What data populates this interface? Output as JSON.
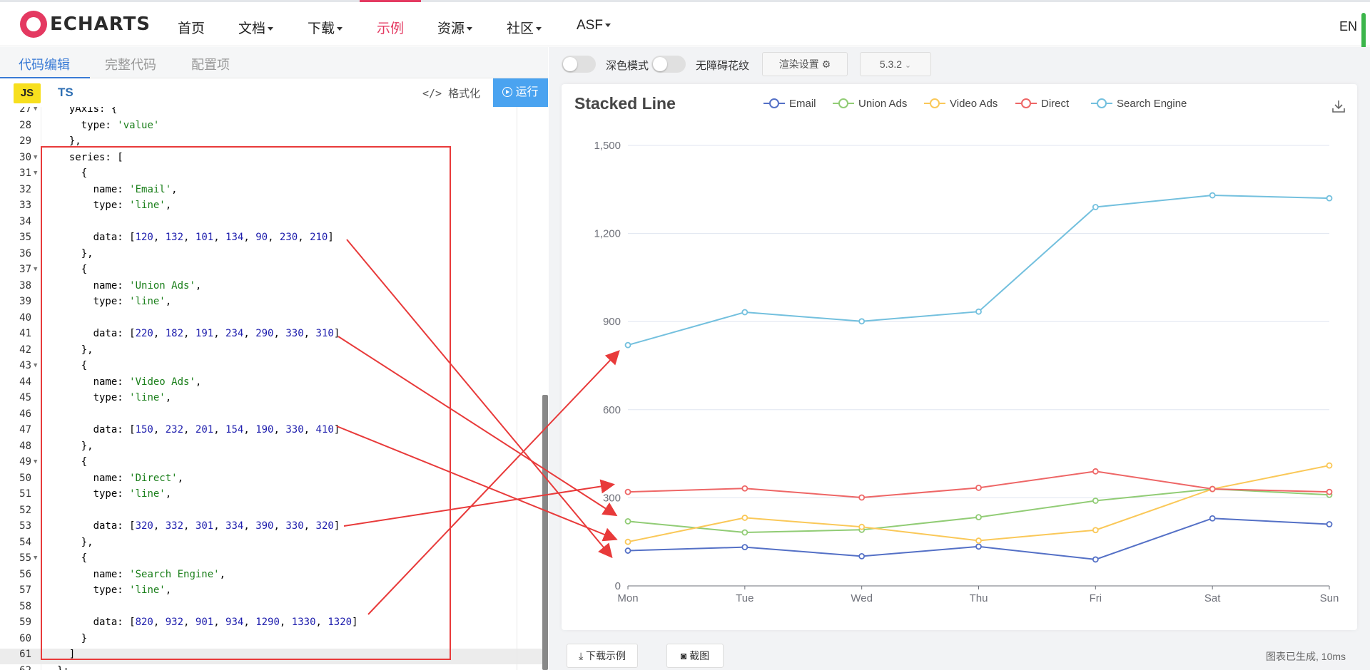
{
  "nav": {
    "logo_text": "ECHARTS",
    "items": [
      {
        "label": "首页",
        "dropdown": false,
        "active": false
      },
      {
        "label": "文档",
        "dropdown": true,
        "active": false
      },
      {
        "label": "下载",
        "dropdown": true,
        "active": false
      },
      {
        "label": "示例",
        "dropdown": false,
        "active": true
      },
      {
        "label": "资源",
        "dropdown": true,
        "active": false
      },
      {
        "label": "社区",
        "dropdown": true,
        "active": false
      },
      {
        "label": "ASF",
        "dropdown": true,
        "active": false
      }
    ],
    "lang": "EN",
    "active_color": "#e43961"
  },
  "editor": {
    "tabs": [
      "代码编辑",
      "完整代码",
      "配置项"
    ],
    "active_tab": "代码编辑",
    "lang_js": "JS",
    "lang_ts": "TS",
    "format_label": "格式化",
    "run_label": "运行",
    "lines": [
      {
        "n": "27",
        "fold": true,
        "text": "  yAxis: {"
      },
      {
        "n": "28",
        "fold": false,
        "text": "    type: 'value'"
      },
      {
        "n": "29",
        "fold": false,
        "text": "  },"
      },
      {
        "n": "30",
        "fold": true,
        "text": "  series: ["
      },
      {
        "n": "31",
        "fold": true,
        "text": "    {"
      },
      {
        "n": "32",
        "fold": false,
        "text": "      name: 'Email',"
      },
      {
        "n": "33",
        "fold": false,
        "text": "      type: 'line',"
      },
      {
        "n": "34",
        "fold": false,
        "text": ""
      },
      {
        "n": "35",
        "fold": false,
        "text": "      data: [120, 132, 101, 134, 90, 230, 210]"
      },
      {
        "n": "36",
        "fold": false,
        "text": "    },"
      },
      {
        "n": "37",
        "fold": true,
        "text": "    {"
      },
      {
        "n": "38",
        "fold": false,
        "text": "      name: 'Union Ads',"
      },
      {
        "n": "39",
        "fold": false,
        "text": "      type: 'line',"
      },
      {
        "n": "40",
        "fold": false,
        "text": ""
      },
      {
        "n": "41",
        "fold": false,
        "text": "      data: [220, 182, 191, 234, 290, 330, 310]"
      },
      {
        "n": "42",
        "fold": false,
        "text": "    },"
      },
      {
        "n": "43",
        "fold": true,
        "text": "    {"
      },
      {
        "n": "44",
        "fold": false,
        "text": "      name: 'Video Ads',"
      },
      {
        "n": "45",
        "fold": false,
        "text": "      type: 'line',"
      },
      {
        "n": "46",
        "fold": false,
        "text": ""
      },
      {
        "n": "47",
        "fold": false,
        "text": "      data: [150, 232, 201, 154, 190, 330, 410]"
      },
      {
        "n": "48",
        "fold": false,
        "text": "    },"
      },
      {
        "n": "49",
        "fold": true,
        "text": "    {"
      },
      {
        "n": "50",
        "fold": false,
        "text": "      name: 'Direct',"
      },
      {
        "n": "51",
        "fold": false,
        "text": "      type: 'line',"
      },
      {
        "n": "52",
        "fold": false,
        "text": ""
      },
      {
        "n": "53",
        "fold": false,
        "text": "      data: [320, 332, 301, 334, 390, 330, 320]"
      },
      {
        "n": "54",
        "fold": false,
        "text": "    },"
      },
      {
        "n": "55",
        "fold": true,
        "text": "    {"
      },
      {
        "n": "56",
        "fold": false,
        "text": "      name: 'Search Engine',"
      },
      {
        "n": "57",
        "fold": false,
        "text": "      type: 'line',"
      },
      {
        "n": "58",
        "fold": false,
        "text": ""
      },
      {
        "n": "59",
        "fold": false,
        "text": "      data: [820, 932, 901, 934, 1290, 1330, 1320]"
      },
      {
        "n": "60",
        "fold": false,
        "text": "    }"
      },
      {
        "n": "61",
        "fold": false,
        "text": "  ]"
      },
      {
        "n": "62",
        "fold": false,
        "text": "};"
      }
    ]
  },
  "toolbar": {
    "dark_mode_label": "深色模式",
    "a11y_label": "无障碍花纹",
    "render_settings_label": "渲染设置",
    "version": "5.3.2"
  },
  "footer": {
    "download_label": "下载示例",
    "screenshot_label": "截图",
    "status": "图表已生成, 10ms"
  },
  "chart_data": {
    "type": "line",
    "title": "Stacked Line",
    "categories": [
      "Mon",
      "Tue",
      "Wed",
      "Thu",
      "Fri",
      "Sat",
      "Sun"
    ],
    "ylim": [
      0,
      1500
    ],
    "yticks": [
      "0",
      "300",
      "600",
      "900",
      "1,200",
      "1,500"
    ],
    "grid": true,
    "legend_position": "top",
    "series": [
      {
        "name": "Email",
        "color": "#5470c6",
        "values": [
          120,
          132,
          101,
          134,
          90,
          230,
          210
        ]
      },
      {
        "name": "Union Ads",
        "color": "#91cc75",
        "values": [
          220,
          182,
          191,
          234,
          290,
          330,
          310
        ]
      },
      {
        "name": "Video Ads",
        "color": "#fac858",
        "values": [
          150,
          232,
          201,
          154,
          190,
          330,
          410
        ]
      },
      {
        "name": "Direct",
        "color": "#ee6666",
        "values": [
          320,
          332,
          301,
          334,
          390,
          330,
          320
        ]
      },
      {
        "name": "Search Engine",
        "color": "#73c0de",
        "values": [
          820,
          932,
          901,
          934,
          1290,
          1330,
          1320
        ]
      }
    ]
  }
}
